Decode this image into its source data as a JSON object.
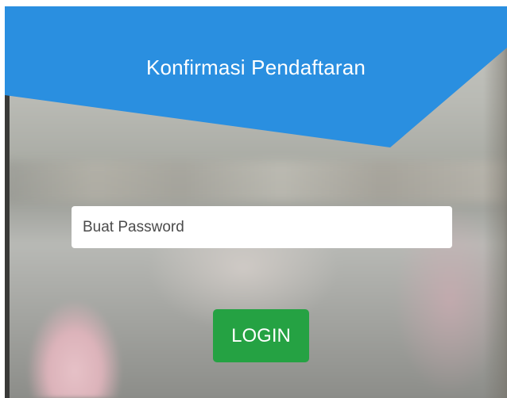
{
  "header": {
    "title": "Konfirmasi Pendaftaran",
    "color": "#2a8fe0"
  },
  "form": {
    "password_placeholder": "Buat Password",
    "password_value": "",
    "login_label": "LOGIN",
    "login_color": "#25a243"
  }
}
